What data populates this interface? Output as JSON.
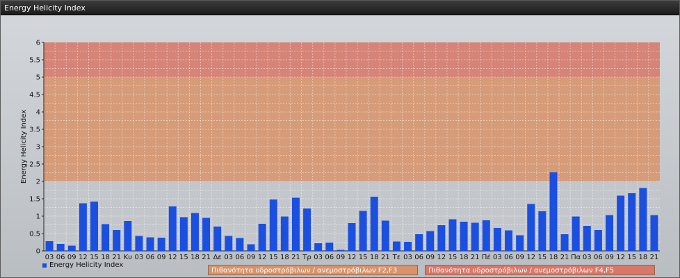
{
  "window": {
    "title": "Energy Helicity Index"
  },
  "legend": {
    "series_label": "Energy Helicity Index"
  },
  "zones": [
    {
      "label": "Πιθανότητα υδροστρόβιλων / ανεμοστρόβιλων F2,F3",
      "from": 2,
      "to": 5,
      "color": "#d9936a"
    },
    {
      "label": "Πιθανότητα υδροστρόβιλων / ανεμοστρόβιλων F4,F5",
      "from": 5,
      "to": 6,
      "color": "#d97868"
    }
  ],
  "chart_data": {
    "type": "bar",
    "ylabel": "Energy Helicity Index",
    "ylim": [
      0,
      6
    ],
    "yticks": [
      "0",
      "0.5",
      "1",
      "1.5",
      "2",
      "2.5",
      "3",
      "3.5",
      "4",
      "4.5",
      "5",
      "5.5",
      "6"
    ],
    "grid": true,
    "legend_position": "bottom-left",
    "bar_color": "#1a4fe0",
    "categories": [
      "03",
      "06",
      "09",
      "12",
      "15",
      "18",
      "21",
      "Κυ",
      "03",
      "06",
      "09",
      "12",
      "15",
      "18",
      "21",
      "Δε",
      "03",
      "06",
      "09",
      "12",
      "15",
      "18",
      "21",
      "Τρ",
      "03",
      "06",
      "09",
      "12",
      "15",
      "18",
      "21",
      "Τε",
      "03",
      "06",
      "09",
      "12",
      "15",
      "18",
      "21",
      "Πέ",
      "03",
      "06",
      "09",
      "12",
      "15",
      "18",
      "21",
      "Πα",
      "03",
      "06",
      "09",
      "12",
      "15",
      "18",
      "21"
    ],
    "values": [
      0.28,
      0.2,
      0.15,
      1.37,
      1.42,
      0.77,
      0.6,
      0.86,
      0.43,
      0.39,
      0.38,
      1.28,
      0.97,
      1.09,
      0.95,
      0.7,
      0.43,
      0.37,
      0.19,
      0.78,
      1.48,
      0.99,
      1.53,
      1.22,
      0.22,
      0.24,
      0.03,
      0.8,
      1.15,
      1.56,
      0.87,
      0.27,
      0.26,
      0.48,
      0.57,
      0.74,
      0.91,
      0.84,
      0.81,
      0.88,
      0.66,
      0.59,
      0.45,
      1.35,
      1.14,
      2.26,
      0.48,
      0.99,
      0.72,
      0.6,
      1.03,
      1.59,
      1.66,
      1.81,
      1.03
    ]
  }
}
